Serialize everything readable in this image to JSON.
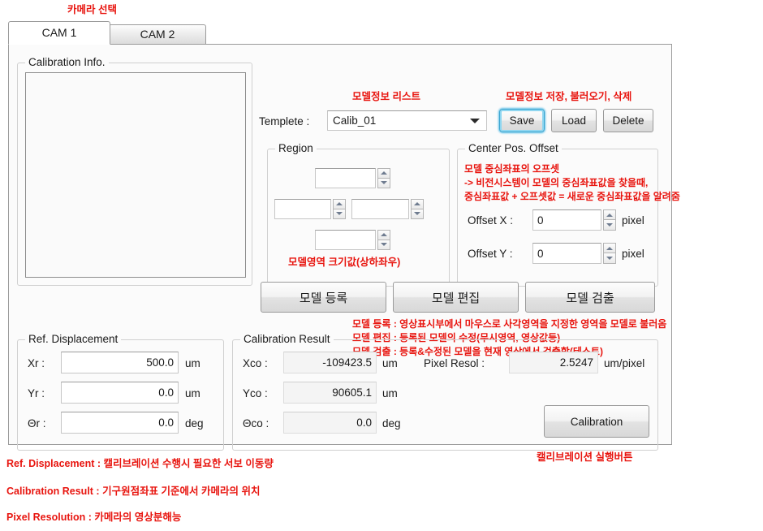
{
  "annotations": {
    "camera_select": "카메라 선택",
    "model_info_list": "모델정보 리스트",
    "model_info_actions": "모델정보 저장, 불러오기, 삭제",
    "center_offset_1": "모델 중심좌표의 오프셋",
    "center_offset_2": "-> 비전시스템이 모델의 중심좌표값을 찾을때,",
    "center_offset_3": "중심좌표값 + 오프셋값 = 새로운 중심좌표값을 알려줌",
    "region_size": "모델영역 크기값(상하좌우)",
    "model_line_1": "모델 등록 : 영상표시부에서 마우스로 사각영역을 지정한 영역을 모델로 불러옴",
    "model_line_2": "모델 편집 : 등록된 모델의 수정(무시영역, 영상값등)",
    "model_line_3": "모델 검출 : 등록&수정된 모델을 현재 영상에서 검출함(테스트)",
    "calibration_button_note": "캘리브레이션 실행버튼"
  },
  "legend": [
    "Ref. Displacement : 캘리브레이션 수행시 필요한 서보 이동량",
    "Calibration Result : 기구원점좌표 기준에서 카메라의 위치",
    "Pixel Resolution : 카메라의 영상분해능"
  ],
  "tabs": [
    {
      "label": "CAM 1",
      "active": true
    },
    {
      "label": "CAM 2",
      "active": false
    }
  ],
  "calibration_info": {
    "caption": "Calibration Info.",
    "list_items": []
  },
  "template": {
    "label": "Templete :",
    "value": "Calib_01",
    "options": [
      "Calib_01"
    ],
    "buttons": [
      {
        "name": "save",
        "label": "Save",
        "focused": true
      },
      {
        "name": "load",
        "label": "Load",
        "focused": false
      },
      {
        "name": "delete",
        "label": "Delete",
        "focused": false
      }
    ]
  },
  "region": {
    "caption": "Region",
    "fields": [
      {
        "name": "top",
        "value": ""
      },
      {
        "name": "left",
        "value": ""
      },
      {
        "name": "right",
        "value": ""
      },
      {
        "name": "bottom",
        "value": ""
      }
    ]
  },
  "center_offset": {
    "caption": "Center Pos. Offset",
    "offset_x": {
      "label": "Offset X :",
      "value": "0",
      "unit": "pixel"
    },
    "offset_y": {
      "label": "Offset Y :",
      "value": "0",
      "unit": "pixel"
    }
  },
  "model_buttons": [
    {
      "name": "register",
      "label": "모델 등록"
    },
    {
      "name": "edit",
      "label": "모델 편집"
    },
    {
      "name": "detect",
      "label": "모델 검출"
    }
  ],
  "ref_displacement": {
    "caption": "Ref. Displacement",
    "rows": [
      {
        "label": "Xr :",
        "value": "500.0",
        "unit": "um"
      },
      {
        "label": "Yr :",
        "value": "0.0",
        "unit": "um"
      },
      {
        "label": "Θr :",
        "value": "0.0",
        "unit": "deg"
      }
    ]
  },
  "calibration_result": {
    "caption": "Calibration Result",
    "rows": [
      {
        "label": "Xco :",
        "value": "-109423.5",
        "unit": "um"
      },
      {
        "label": "Yco :",
        "value": "90605.1",
        "unit": "um"
      },
      {
        "label": "Θco :",
        "value": "0.0",
        "unit": "deg"
      }
    ],
    "pixel_resol": {
      "label": "Pixel Resol :",
      "value": "2.5247",
      "unit": "um/pixel"
    },
    "calibration_button": "Calibration"
  },
  "colors": {
    "annotation_red": "#e8150f",
    "focus_cyan": "#63c2e8",
    "panel_bg": "#fbfbfb",
    "border_gray": "#9a9a9a"
  }
}
